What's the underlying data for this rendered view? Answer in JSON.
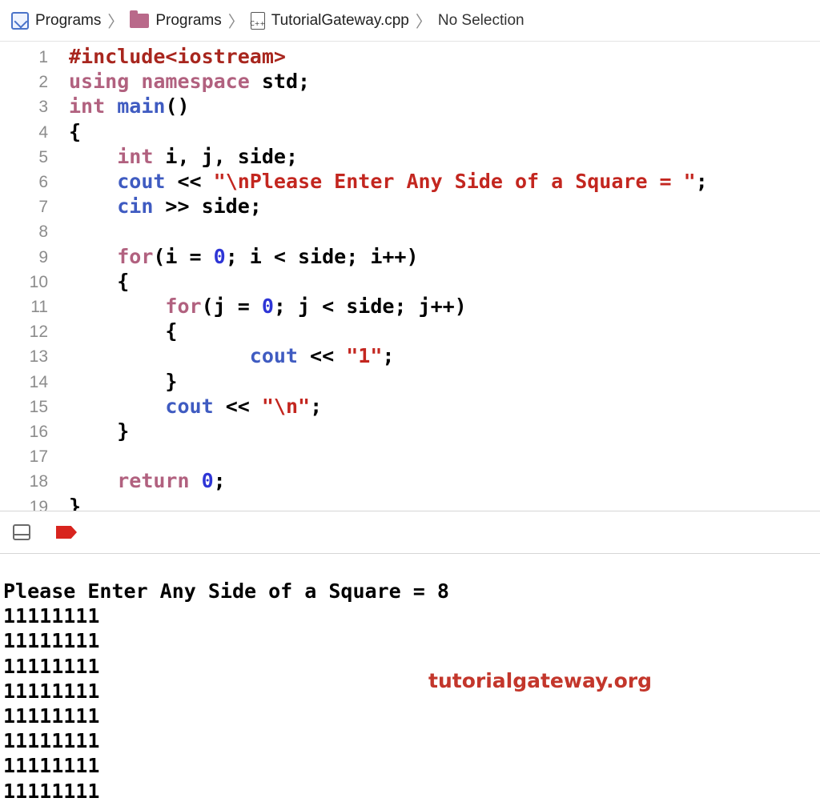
{
  "breadcrumb": {
    "items": [
      "Programs",
      "Programs",
      "TutorialGateway.cpp",
      "No Selection"
    ],
    "file_icon_text": "C++"
  },
  "editor": {
    "lines": [
      {
        "n": "1",
        "tokens": [
          {
            "t": "#include<iostream>",
            "c": "pp"
          }
        ]
      },
      {
        "n": "2",
        "tokens": [
          {
            "t": "using",
            "c": "kw"
          },
          {
            "t": " "
          },
          {
            "t": "namespace",
            "c": "kw"
          },
          {
            "t": " std;"
          }
        ]
      },
      {
        "n": "3",
        "tokens": [
          {
            "t": "int",
            "c": "kw"
          },
          {
            "t": " "
          },
          {
            "t": "main",
            "c": "fn"
          },
          {
            "t": "()"
          }
        ]
      },
      {
        "n": "4",
        "tokens": [
          {
            "t": "{"
          }
        ]
      },
      {
        "n": "5",
        "tokens": [
          {
            "t": "    "
          },
          {
            "t": "int",
            "c": "kw"
          },
          {
            "t": " i, j, side;"
          }
        ]
      },
      {
        "n": "6",
        "tokens": [
          {
            "t": "    "
          },
          {
            "t": "cout",
            "c": "fn"
          },
          {
            "t": " << "
          },
          {
            "t": "\"\\nPlease Enter Any Side of a Square = \"",
            "c": "str"
          },
          {
            "t": ";"
          }
        ]
      },
      {
        "n": "7",
        "tokens": [
          {
            "t": "    "
          },
          {
            "t": "cin",
            "c": "fn"
          },
          {
            "t": " >> side;"
          }
        ]
      },
      {
        "n": "8",
        "tokens": []
      },
      {
        "n": "9",
        "tokens": [
          {
            "t": "    "
          },
          {
            "t": "for",
            "c": "kw"
          },
          {
            "t": "(i = "
          },
          {
            "t": "0",
            "c": "num"
          },
          {
            "t": "; i < side; i++)"
          }
        ]
      },
      {
        "n": "10",
        "tokens": [
          {
            "t": "    {"
          }
        ]
      },
      {
        "n": "11",
        "tokens": [
          {
            "t": "        "
          },
          {
            "t": "for",
            "c": "kw"
          },
          {
            "t": "(j = "
          },
          {
            "t": "0",
            "c": "num"
          },
          {
            "t": "; j < side; j++)"
          }
        ]
      },
      {
        "n": "12",
        "tokens": [
          {
            "t": "        {"
          }
        ]
      },
      {
        "n": "13",
        "tokens": [
          {
            "t": "               "
          },
          {
            "t": "cout",
            "c": "fn"
          },
          {
            "t": " << "
          },
          {
            "t": "\"1\"",
            "c": "str"
          },
          {
            "t": ";"
          }
        ]
      },
      {
        "n": "14",
        "tokens": [
          {
            "t": "        }"
          }
        ]
      },
      {
        "n": "15",
        "tokens": [
          {
            "t": "        "
          },
          {
            "t": "cout",
            "c": "fn"
          },
          {
            "t": " << "
          },
          {
            "t": "\"\\n\"",
            "c": "str"
          },
          {
            "t": ";"
          }
        ]
      },
      {
        "n": "16",
        "tokens": [
          {
            "t": "    }"
          }
        ]
      },
      {
        "n": "17",
        "tokens": []
      },
      {
        "n": "18",
        "tokens": [
          {
            "t": "    "
          },
          {
            "t": "return",
            "c": "kw"
          },
          {
            "t": " "
          },
          {
            "t": "0",
            "c": "num"
          },
          {
            "t": ";"
          }
        ]
      },
      {
        "n": "19",
        "tokens": [
          {
            "t": "}"
          }
        ]
      }
    ]
  },
  "console": {
    "lines": [
      "Please Enter Any Side of a Square = 8",
      "11111111",
      "11111111",
      "11111111",
      "11111111",
      "11111111",
      "11111111",
      "11111111",
      "11111111"
    ]
  },
  "watermark": "tutorialgateway.org",
  "colors": {
    "keyword": "#b1617f",
    "function": "#3f5bc1",
    "string": "#c3261f",
    "number": "#2e35d6",
    "preprocessor": "#a8261e",
    "breakpoint": "#d8241e"
  }
}
